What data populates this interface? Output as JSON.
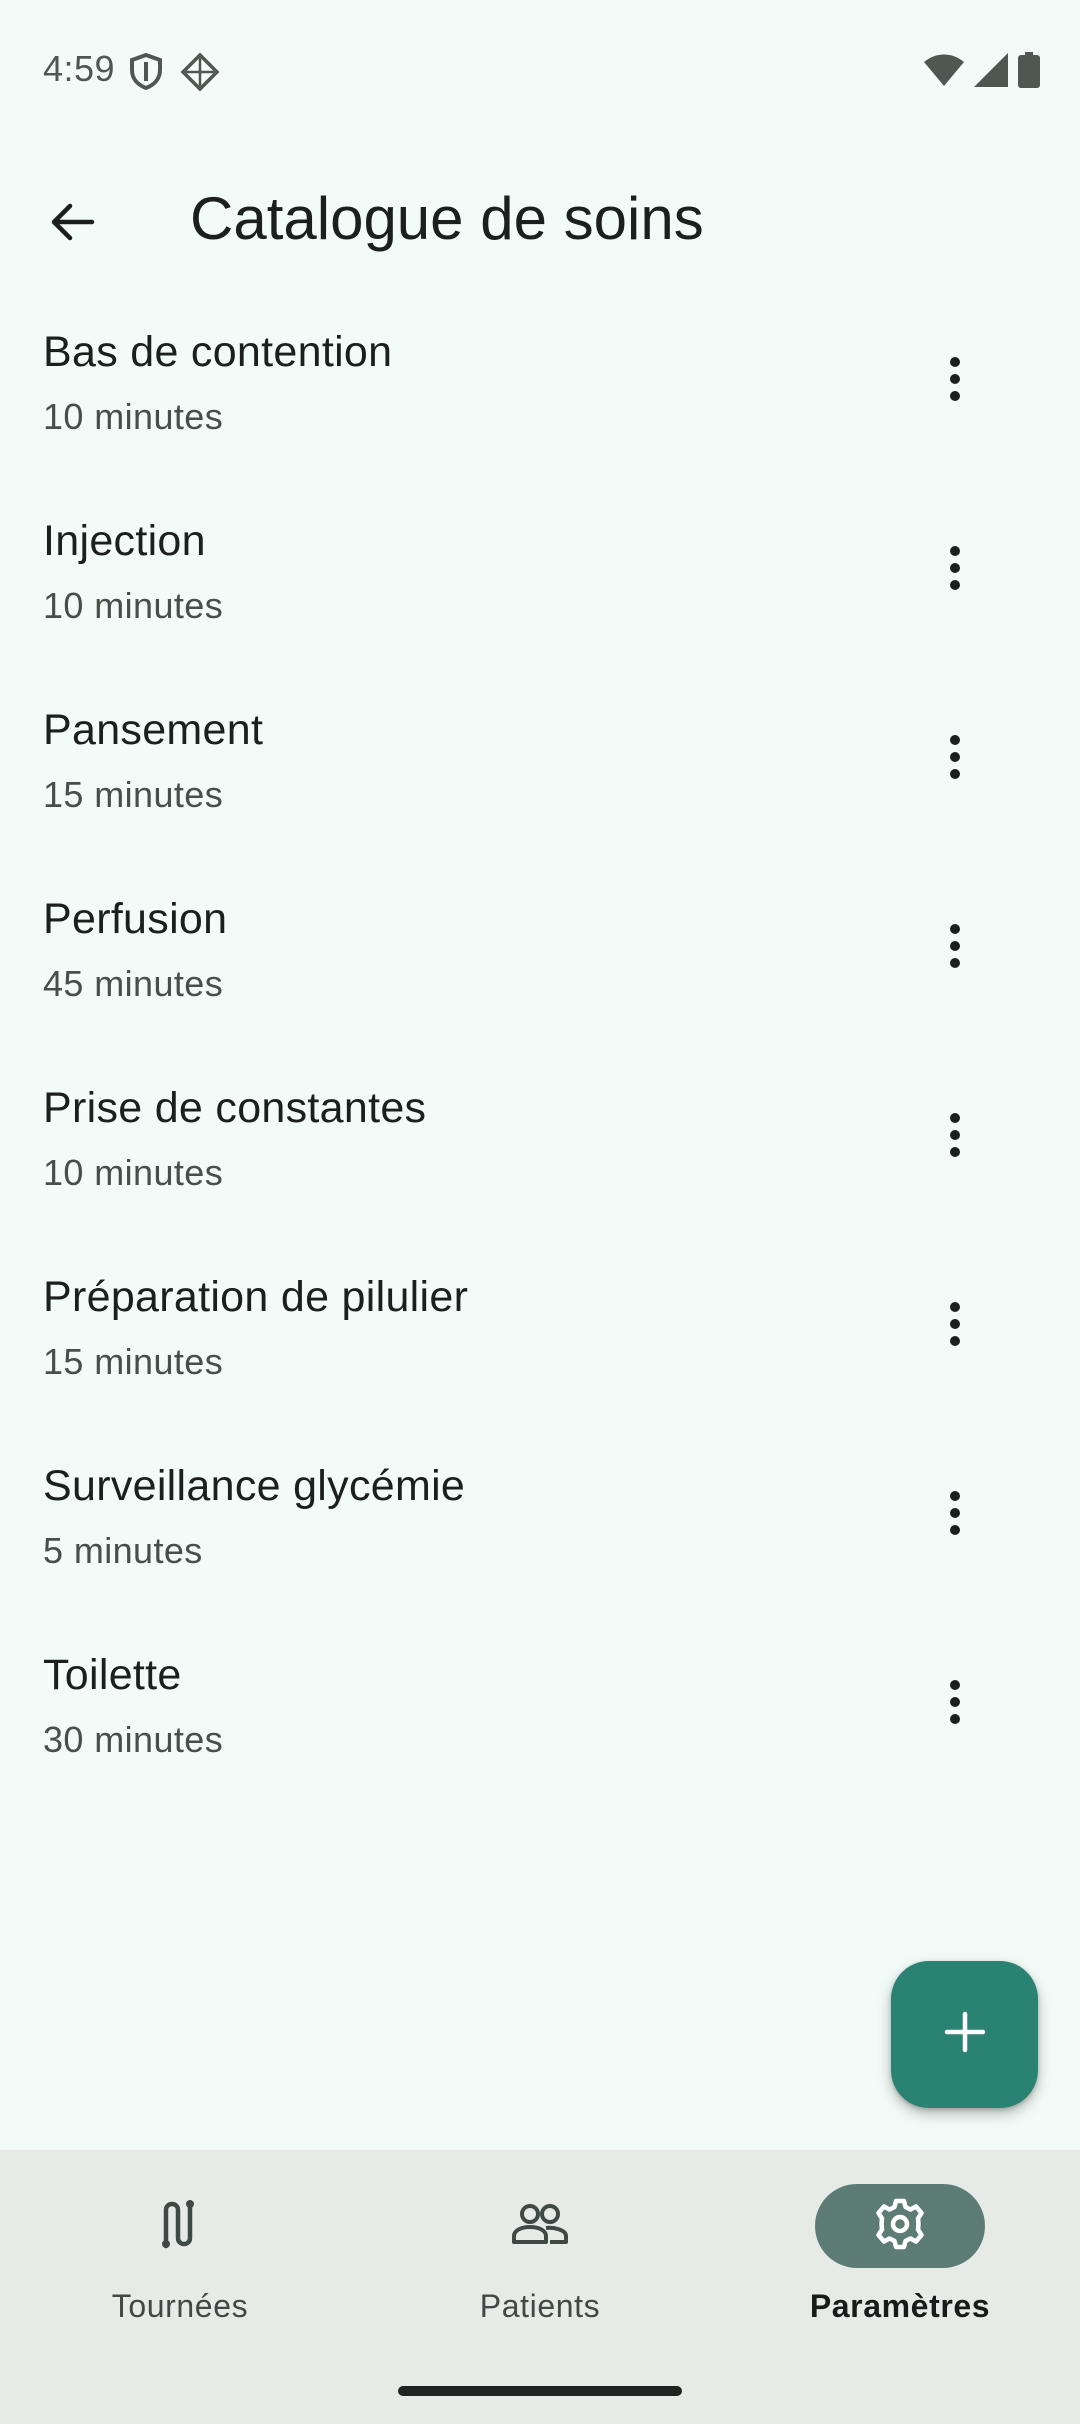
{
  "status_bar": {
    "time": "4:59",
    "left_icons": [
      "shield-icon",
      "diamond-grid-icon"
    ],
    "right_icons": [
      "wifi-icon",
      "cellular-signal-icon",
      "battery-icon"
    ]
  },
  "header": {
    "title": "Catalogue de soins",
    "back_icon": "arrow-left-icon"
  },
  "care_items": [
    {
      "name": "Bas de contention",
      "duration": "10 minutes"
    },
    {
      "name": "Injection",
      "duration": "10 minutes"
    },
    {
      "name": "Pansement",
      "duration": "15 minutes"
    },
    {
      "name": "Perfusion",
      "duration": "45 minutes"
    },
    {
      "name": "Prise de constantes",
      "duration": "10 minutes"
    },
    {
      "name": "Préparation de pilulier",
      "duration": "15 minutes"
    },
    {
      "name": "Surveillance glycémie",
      "duration": "5 minutes"
    },
    {
      "name": "Toilette",
      "duration": "30 minutes"
    }
  ],
  "fab": {
    "icon": "plus-icon"
  },
  "bottom_nav": {
    "items": [
      {
        "label": "Tournées",
        "icon": "route-icon",
        "active": false
      },
      {
        "label": "Patients",
        "icon": "people-icon",
        "active": false
      },
      {
        "label": "Paramètres",
        "icon": "gear-icon",
        "active": true
      }
    ]
  },
  "colors": {
    "background": "#f2fbf7",
    "fab": "#2a8273",
    "nav_background": "#e6ebe8",
    "active_pill": "#5d7d74"
  }
}
